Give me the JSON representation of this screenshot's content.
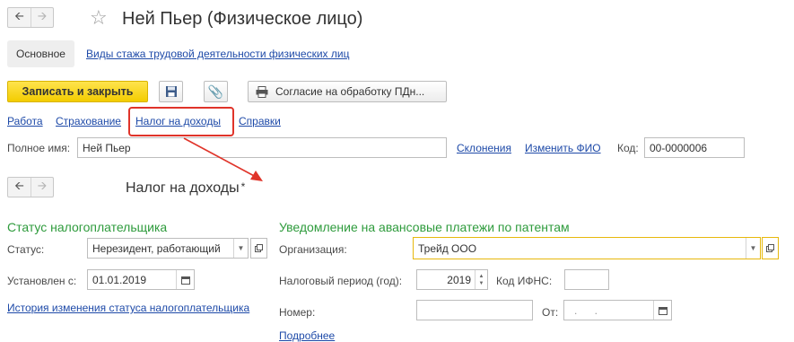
{
  "header": {
    "title": "Ней Пьер (Физическое лицо)"
  },
  "tabs": {
    "main": "Основное",
    "link": "Виды стажа трудовой деятельности физических лиц"
  },
  "toolbar": {
    "save_close": "Записать и закрыть",
    "consent": "Согласие на обработку ПДн..."
  },
  "links": [
    "Работа",
    "Страхование",
    "Налог на доходы",
    "Справки"
  ],
  "fullname": {
    "label": "Полное имя:",
    "value": "Ней Пьер",
    "declensions": "Склонения",
    "change_fio": "Изменить ФИО",
    "code_label": "Код:",
    "code_value": "00-0000006"
  },
  "subform": {
    "title": "Налог на доходы",
    "asterisk": "*"
  },
  "taxpayer_status": {
    "section": "Статус налогоплательщика",
    "status_label": "Статус:",
    "status_value": "Нерезидент, работающий",
    "set_label": "Установлен с:",
    "set_value": "01.01.2019",
    "history_link": "История изменения статуса налогоплательщика"
  },
  "patent_notice": {
    "section": "Уведомление на авансовые платежи по патентам",
    "org_label": "Организация:",
    "org_value": "Трейд ООО",
    "period_label": "Налоговый период (год):",
    "period_value": "2019",
    "ifns_label": "Код ИФНС:",
    "ifns_value": "",
    "number_label": "Номер:",
    "number_value": "",
    "from_label": "От:",
    "from_value": ". .",
    "more_link": "Подробнее"
  },
  "colors": {
    "accent_yellow": "#f5d100",
    "link_blue": "#1e4aa8",
    "section_green": "#2e9b3c",
    "highlight_red": "#e0342a"
  }
}
